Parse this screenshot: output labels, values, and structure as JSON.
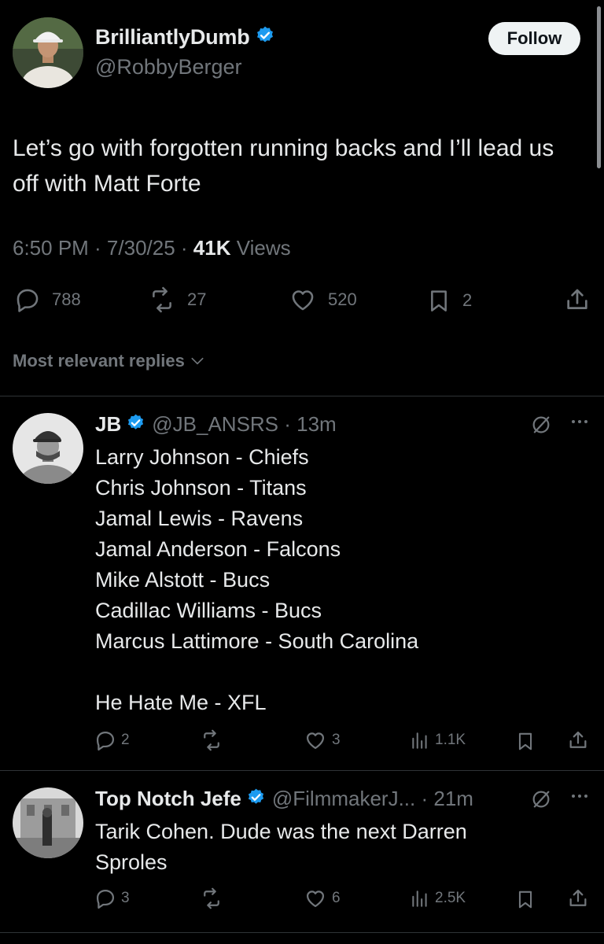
{
  "tweet": {
    "display_name": "BrilliantlyDumb",
    "handle": "@RobbyBerger",
    "follow_label": "Follow",
    "text": "Let’s go with forgotten running backs and I’ll lead us off with Matt Forte",
    "time": "6:50 PM · 7/30/25 · ",
    "views_count": "41K",
    "views_label": " Views",
    "stats": {
      "replies": "788",
      "reposts": "27",
      "likes": "520",
      "bookmarks": "2"
    }
  },
  "sort_label": "Most relevant replies",
  "replies": [
    {
      "display_name": "JB",
      "handle": "@JB_ANSRS · 13m",
      "text": "Larry Johnson - Chiefs\nChris Johnson - Titans\nJamal Lewis - Ravens\nJamal Anderson - Falcons\nMike Alstott - Bucs\nCadillac Williams - Bucs\nMarcus Lattimore - South Carolina\n\nHe Hate Me - XFL",
      "stats": {
        "replies": "2",
        "reposts": "",
        "likes": "3",
        "views": "1.1K"
      }
    },
    {
      "display_name": "Top Notch Jefe",
      "handle": "@FilmmakerJ... · 21m",
      "text": "Tarik Cohen. Dude was the next Darren Sproles",
      "stats": {
        "replies": "3",
        "reposts": "",
        "likes": "6",
        "views": "2.5K"
      }
    }
  ],
  "colors": {
    "background": "#000000",
    "text": "#e7e9ea",
    "muted": "#71767b",
    "verified": "#1d9bf0",
    "divider": "#2f3336"
  },
  "icons": [
    "verified-badge-icon",
    "reply-icon",
    "repost-icon",
    "like-icon",
    "bookmark-icon",
    "share-icon",
    "views-icon",
    "chevron-down-icon",
    "grok-icon",
    "more-icon"
  ]
}
